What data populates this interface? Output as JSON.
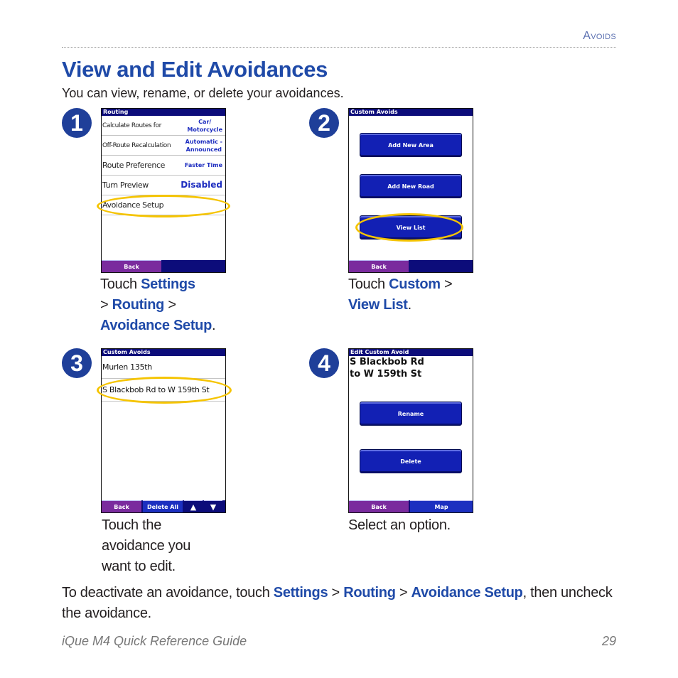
{
  "header": {
    "section": "Avoids",
    "title": "View and Edit Avoidances",
    "intro": "You can view, rename, or delete your avoidances."
  },
  "steps": [
    {
      "number": "1",
      "screen": {
        "title": "Routing",
        "rows": [
          {
            "label": "Calculate Routes for",
            "value_line1": "Car/",
            "value_line2": "Motorcycle"
          },
          {
            "label": "Off-Route Recalculation",
            "value_line1": "Automatic -",
            "value_line2": "Announced"
          },
          {
            "label": "Route Preference",
            "value_line1": "Faster Time",
            "value_line2": ""
          },
          {
            "label": "Turn Preview",
            "value_line1": "Disabled",
            "value_line2": ""
          },
          {
            "label": "Avoidance Setup",
            "value_line1": "",
            "value_line2": ""
          }
        ],
        "bottom_buttons": [
          "Back"
        ]
      },
      "caption": {
        "t1": "Touch ",
        "b1": "Settings",
        "t2": " > ",
        "b2": "Routing",
        "t3": " > ",
        "b3": "Avoidance Setup",
        "t4": "."
      }
    },
    {
      "number": "2",
      "screen": {
        "title": "Custom Avoids",
        "buttons": [
          "Add New Area",
          "Add New Road",
          "View List"
        ],
        "bottom_buttons": [
          "Back"
        ]
      },
      "caption": {
        "t1": "Touch ",
        "b1": "Custom",
        "t2": " > ",
        "b2": "View List",
        "t3": "."
      }
    },
    {
      "number": "3",
      "screen": {
        "title": "Custom Avoids",
        "items": [
          "Murlen 135th",
          "S Blackbob Rd to W 159th St"
        ],
        "bottom_buttons": [
          "Back",
          "Delete All",
          "▲",
          "▼"
        ]
      },
      "caption": {
        "line1": "Touch the",
        "line2": "avoidance you",
        "line3": "want to edit."
      }
    },
    {
      "number": "4",
      "screen": {
        "title": "Edit Custom Avoid",
        "name_line1": "S Blackbob Rd",
        "name_line2": "to W 159th St",
        "buttons": [
          "Rename",
          "Delete"
        ],
        "bottom_buttons": [
          "Back",
          "Map"
        ]
      },
      "caption": {
        "text": "Select an option."
      }
    }
  ],
  "note": {
    "t1": "To deactivate an avoidance, touch ",
    "b1": "Settings",
    "t2": " > ",
    "b2": "Routing",
    "t3": " > ",
    "b3": "Avoidance Setup",
    "t4": ", then uncheck the avoidance."
  },
  "footer": {
    "guide": "iQue M4 Quick Reference Guide",
    "page": "29"
  },
  "colors": {
    "accent_blue": "#1f4aa8",
    "highlight_yellow": "#f5c400",
    "screen_titlebar": "#0c0c7a",
    "back_button": "#7a2b9e"
  }
}
